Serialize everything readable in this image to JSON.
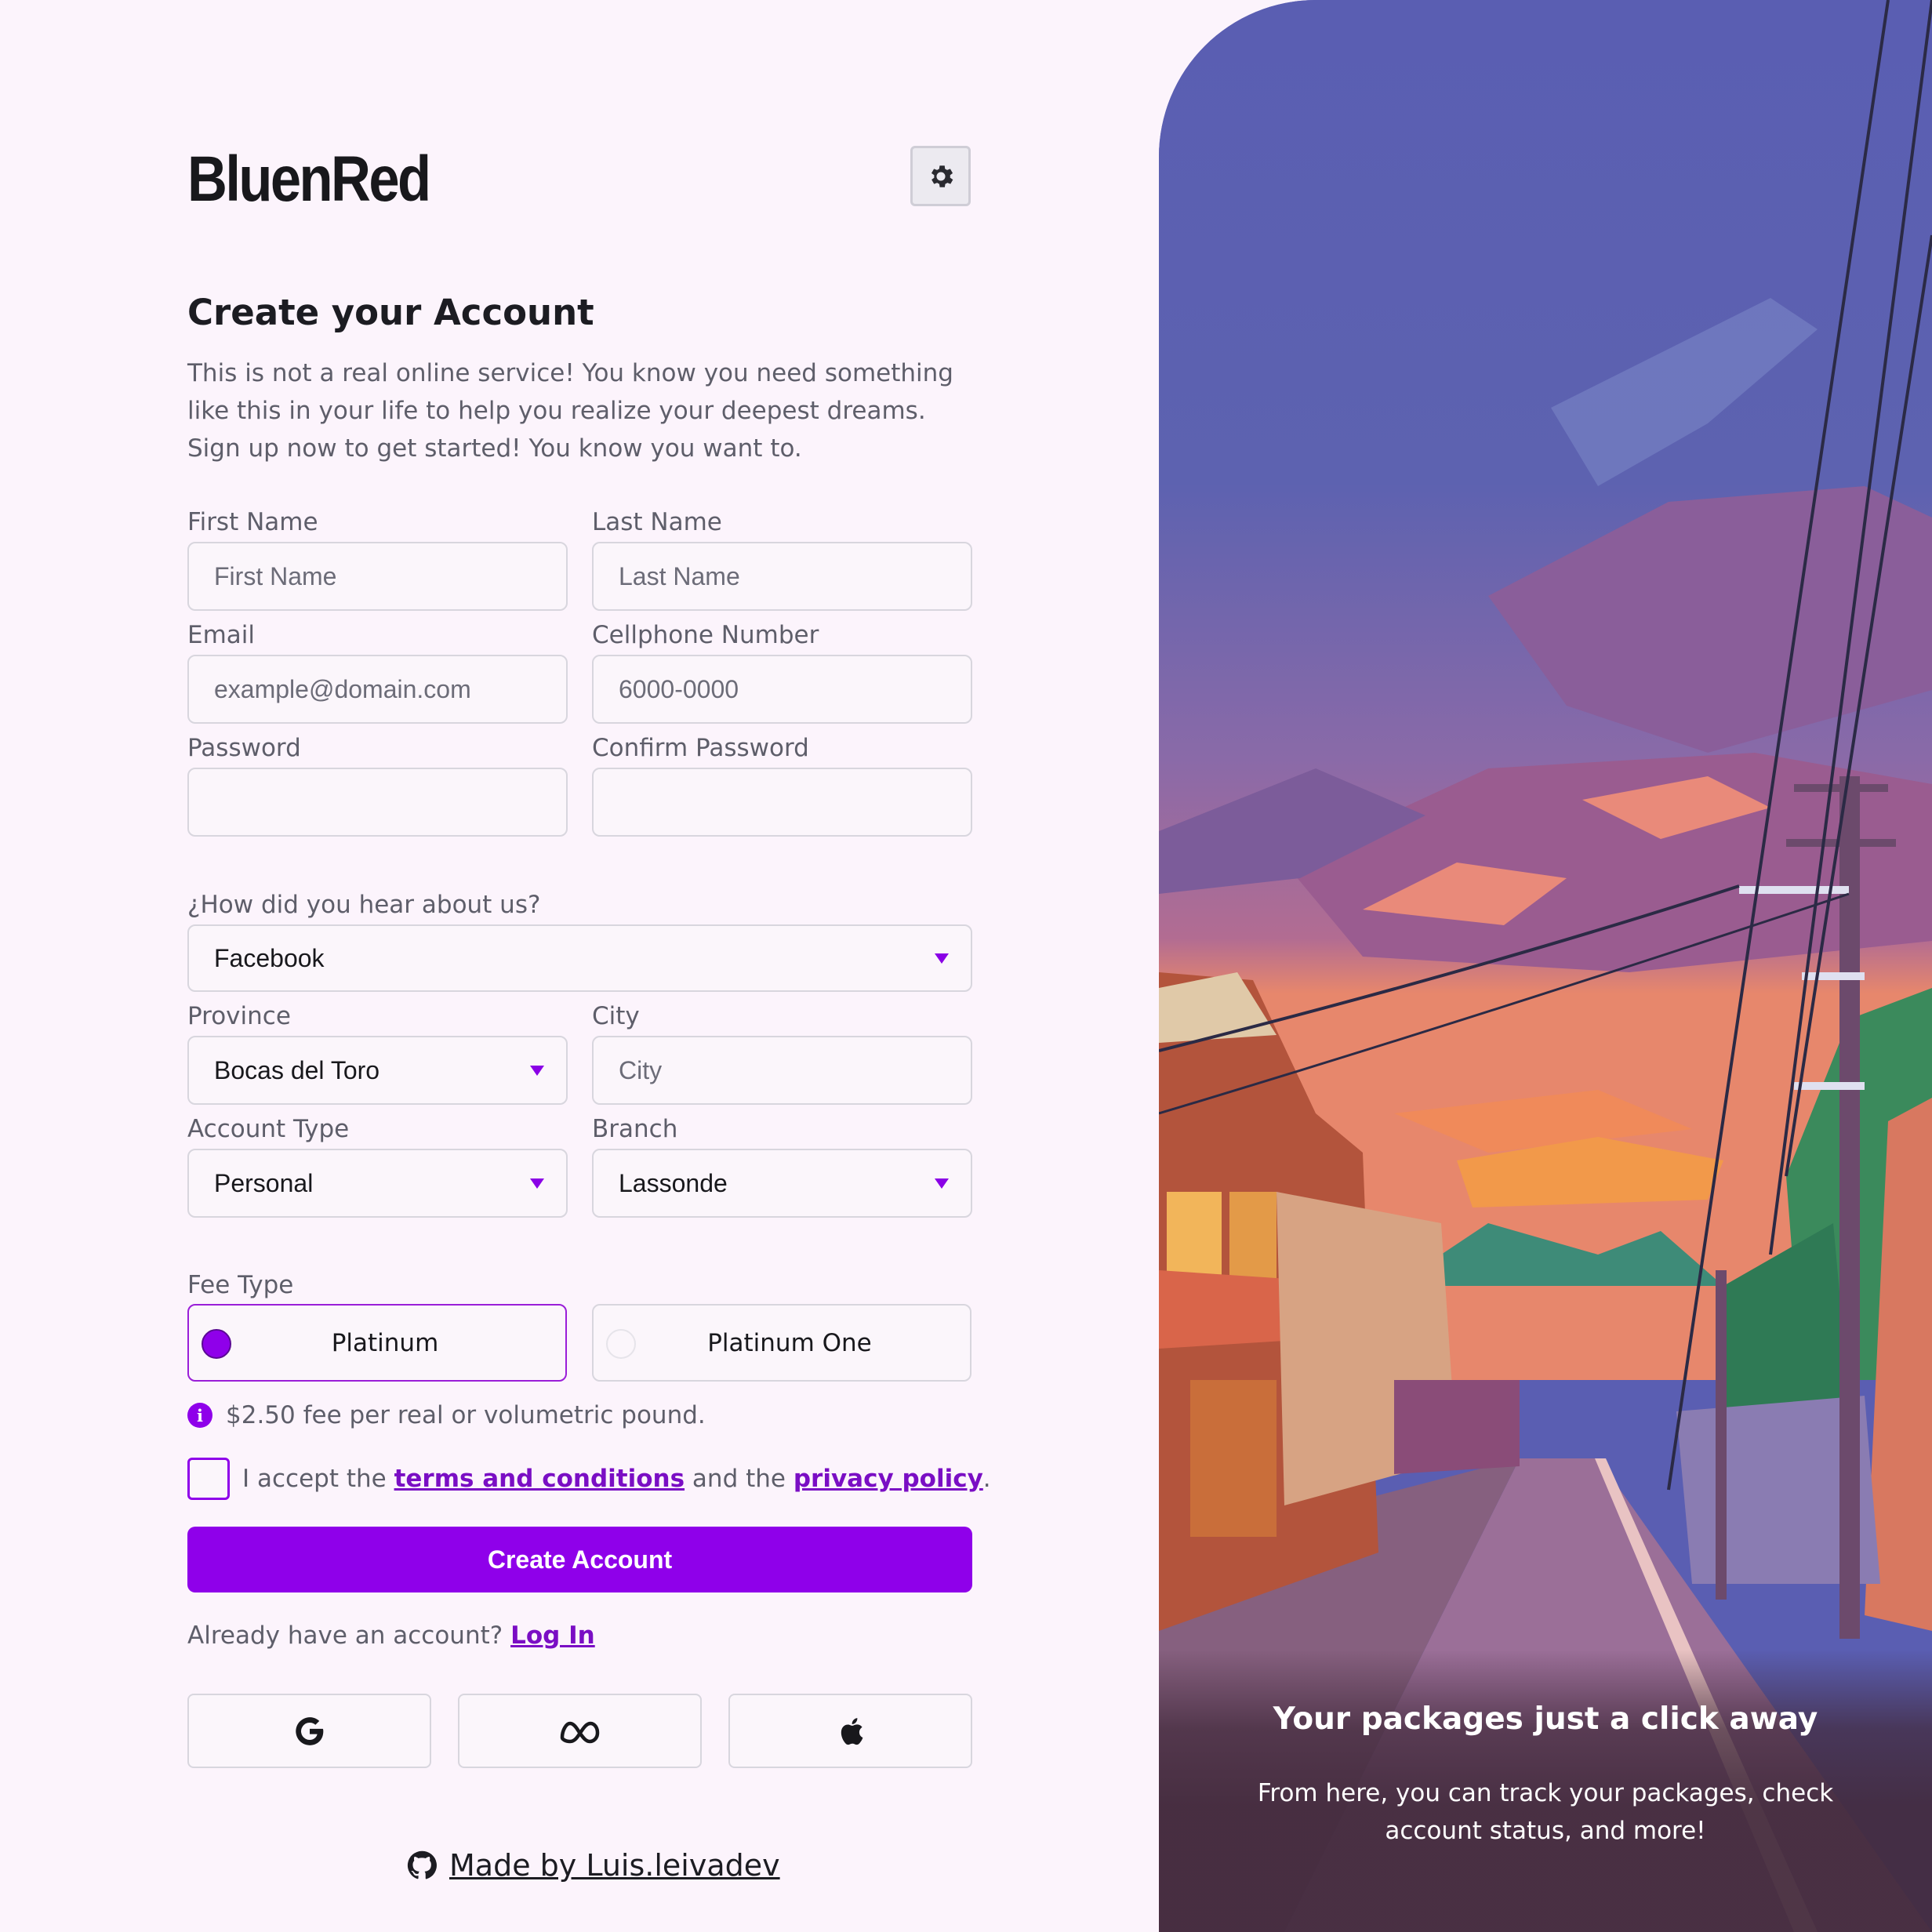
{
  "brand": "BluenRed",
  "theme_toggle": {
    "icon": "gear-icon"
  },
  "form": {
    "title": "Create your Account",
    "intro": "This is not a real online service! You know you need something like this in your life to help you realize your deepest dreams. Sign up now to get started! You know you want to.",
    "first_name": {
      "label": "First Name",
      "placeholder": "First Name",
      "value": ""
    },
    "last_name": {
      "label": "Last Name",
      "placeholder": "Last Name",
      "value": ""
    },
    "email": {
      "label": "Email",
      "placeholder": "example@domain.com",
      "value": ""
    },
    "phone": {
      "label": "Cellphone Number",
      "placeholder": "6000-0000",
      "value": ""
    },
    "password": {
      "label": "Password",
      "value": ""
    },
    "confirm_password": {
      "label": "Confirm Password",
      "value": ""
    },
    "referral": {
      "label": "¿How did you hear about us?",
      "value": "Facebook"
    },
    "province": {
      "label": "Province",
      "value": "Bocas del Toro"
    },
    "city": {
      "label": "City",
      "placeholder": "City",
      "value": ""
    },
    "account_type": {
      "label": "Account Type",
      "value": "Personal"
    },
    "branch": {
      "label": "Branch",
      "value": "Lassonde"
    },
    "fee_type": {
      "label": "Fee Type",
      "options": [
        {
          "label": "Platinum",
          "selected": true
        },
        {
          "label": "Platinum One",
          "selected": false
        }
      ],
      "info": "$2.50 fee per real or volumetric pound."
    },
    "terms": {
      "prefix": "I accept the",
      "terms_link": "terms and conditions",
      "middle": "and the",
      "privacy_link": "privacy policy",
      "suffix": ".",
      "checked": false
    },
    "submit_label": "Create Account",
    "login_prompt": "Already have an account?",
    "login_link": "Log In",
    "social": [
      "google-icon",
      "meta-icon",
      "apple-icon"
    ]
  },
  "footer": {
    "text": "Made by Luis.leivadev",
    "icon": "github-icon"
  },
  "panel": {
    "title": "Your packages just a click away",
    "text": "From here, you can track your packages, check account status, and more!"
  },
  "colors": {
    "accent": "#8f00ea",
    "background": "#fcf4fc",
    "panel_sky": "#5a5eb2"
  }
}
